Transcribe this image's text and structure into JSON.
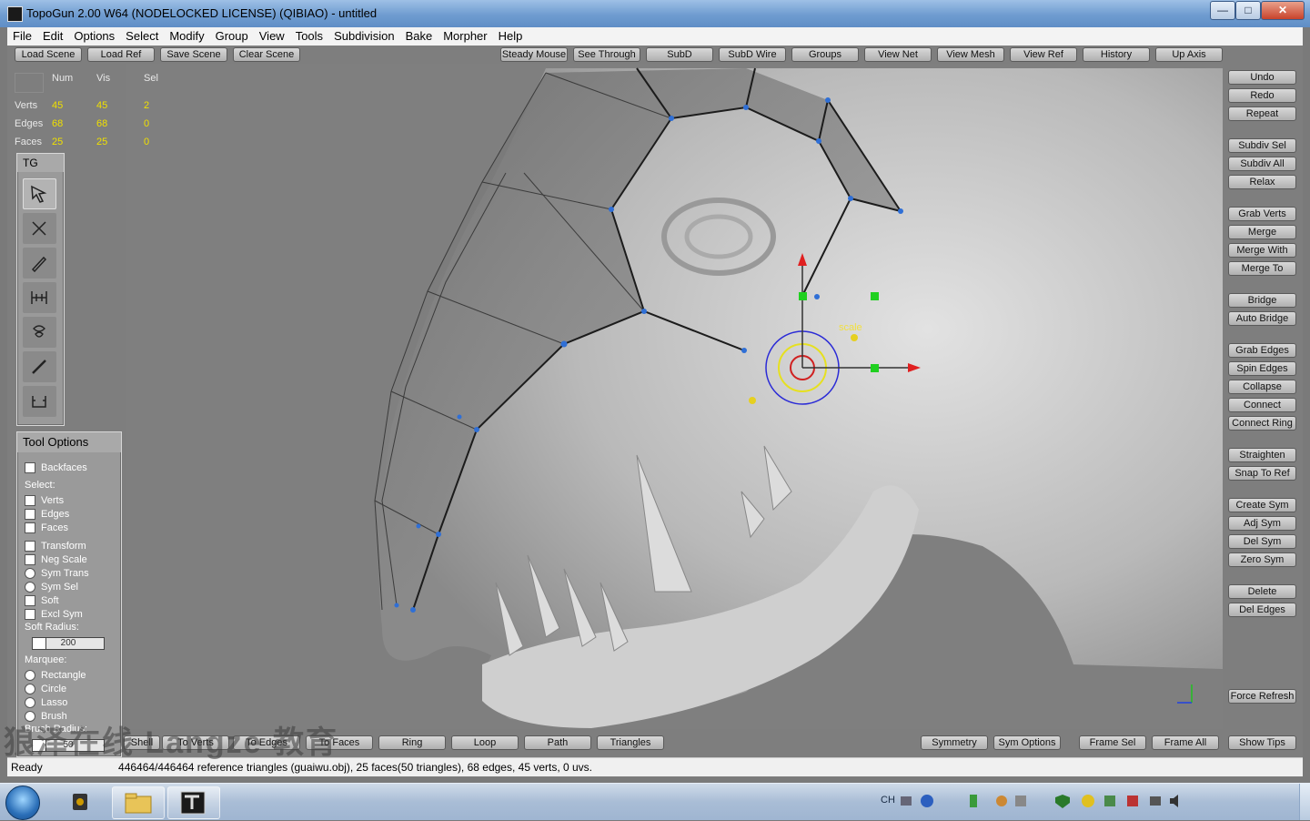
{
  "window": {
    "title": "TopoGun 2.00 W64  (NODELOCKED LICENSE) (QIBIAO) - untitled",
    "minimize": "—",
    "maximize": "□",
    "close": "✕"
  },
  "menu": [
    "File",
    "Edit",
    "Options",
    "Select",
    "Modify",
    "Group",
    "View",
    "Tools",
    "Subdivision",
    "Bake",
    "Morpher",
    "Help"
  ],
  "toolbar_left": [
    "Load Scene",
    "Load Ref",
    "Save Scene",
    "Clear Scene"
  ],
  "toolbar_top": [
    "Steady Mouse",
    "See Through",
    "SubD",
    "SubD Wire",
    "Groups",
    "View Net",
    "View Mesh",
    "View Ref",
    "History",
    "Up Axis"
  ],
  "stats": {
    "headers": [
      "Num",
      "Vis",
      "Sel"
    ],
    "rows": [
      {
        "label": "Verts",
        "num": "45",
        "vis": "45",
        "sel": "2"
      },
      {
        "label": "Edges",
        "num": "68",
        "vis": "68",
        "sel": "0"
      },
      {
        "label": "Faces",
        "num": "25",
        "vis": "25",
        "sel": "0"
      }
    ]
  },
  "tools_panel": {
    "title": "TG",
    "tools": [
      "select-tool-icon",
      "knife-tool-icon",
      "draw-tool-icon",
      "bridge-tool-icon",
      "brush-tool-icon",
      "tubes-tool-icon",
      "extrude-tool-icon"
    ]
  },
  "tool_options": {
    "title": "Tool Options",
    "backfaces": "Backfaces",
    "select_label": "Select:",
    "select": [
      "Verts",
      "Edges",
      "Faces"
    ],
    "transform": [
      "Transform",
      "Neg Scale",
      "Sym Trans",
      "Sym Sel",
      "Soft",
      "Excl Sym"
    ],
    "soft_radius_label": "Soft Radius:",
    "soft_radius_value": "200",
    "marquee_label": "Marquee:",
    "marquee": [
      "Rectangle",
      "Circle",
      "Lasso",
      "Brush"
    ],
    "brush_radius_label": "Brush Radius:",
    "brush_radius_value": "50"
  },
  "right_buttons": [
    "Undo",
    "Redo",
    "Repeat",
    "Subdiv Sel",
    "Subdiv All",
    "Relax",
    "Grab Verts",
    "Merge",
    "Merge With",
    "Merge To",
    "Bridge",
    "Auto Bridge",
    "Grab Edges",
    "Spin Edges",
    "Collapse",
    "Connect",
    "Connect Ring",
    "Straighten",
    "Snap To Ref",
    "Create Sym",
    "Adj Sym",
    "Del Sym",
    "Zero Sym",
    "Delete",
    "Del Edges",
    "Force Refresh"
  ],
  "bottom_left": [
    "Shell",
    "To Verts",
    "To Edges",
    "To Faces",
    "Ring",
    "Loop",
    "Path",
    "Triangles"
  ],
  "bottom_right": [
    "Symmetry",
    "Sym Options",
    "Frame Sel",
    "Frame All",
    "Show Tips"
  ],
  "gizmo": {
    "scale_label": "scale"
  },
  "status": {
    "ready": "Ready",
    "text": "446464/446464 reference triangles (guaiwu.obj), 25 faces(50 triangles), 68 edges, 45 verts, 0 uvs."
  },
  "watermark": "狼泽在线 Langze 教育",
  "taskbar": {
    "lang": "CH"
  }
}
